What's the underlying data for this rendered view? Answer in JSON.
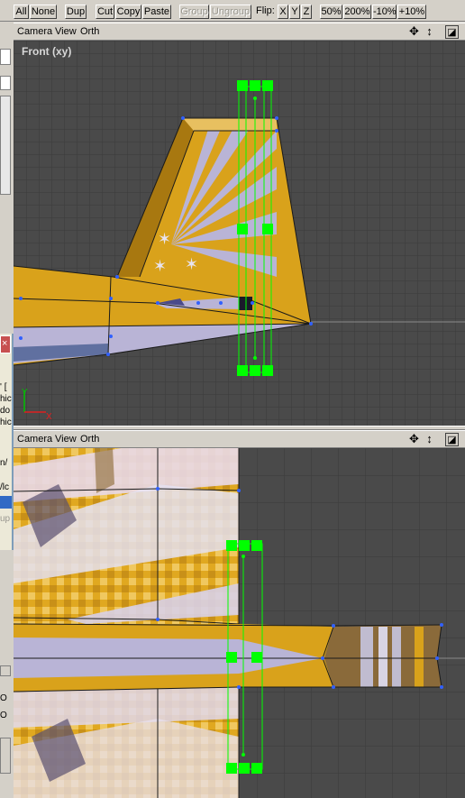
{
  "toolbar": {
    "all": "All",
    "none": "None",
    "dup": "Dup",
    "cut": "Cut",
    "copy": "Copy",
    "paste": "Paste",
    "group": "Group",
    "ungroup": "Ungroup",
    "flip_label": "Flip:",
    "flip_x": "X",
    "flip_y": "Y",
    "flip_z": "Z",
    "zoom_50": "50%",
    "zoom_200": "200%",
    "zoom_minus10": "-10%",
    "zoom_plus10": "+10%"
  },
  "viewports": [
    {
      "menu_camera": "Camera",
      "menu_view": "View",
      "menu_orth": "Orth",
      "label": "Front (xy)",
      "icons": [
        "move-icon",
        "maximize-icon"
      ]
    },
    {
      "menu_camera": "Camera",
      "menu_view": "View",
      "menu_orth": "Orth",
      "label": "",
      "icons": [
        "move-icon",
        "maximize-icon"
      ]
    }
  ],
  "left_panel": {
    "fragments": [
      "' [",
      "hic",
      "do",
      "hic",
      "n/",
      "/lc",
      "up"
    ],
    "lower_fragments": [
      "O",
      "O"
    ]
  },
  "colors": {
    "grid_bg": "#4a4a4a",
    "grid_line": "#3a3a3a",
    "selection_green": "#00ff00",
    "vertex_blue": "#3060ff",
    "texture_orange": "#d9a21b",
    "texture_lavender": "#b9b4d6"
  }
}
